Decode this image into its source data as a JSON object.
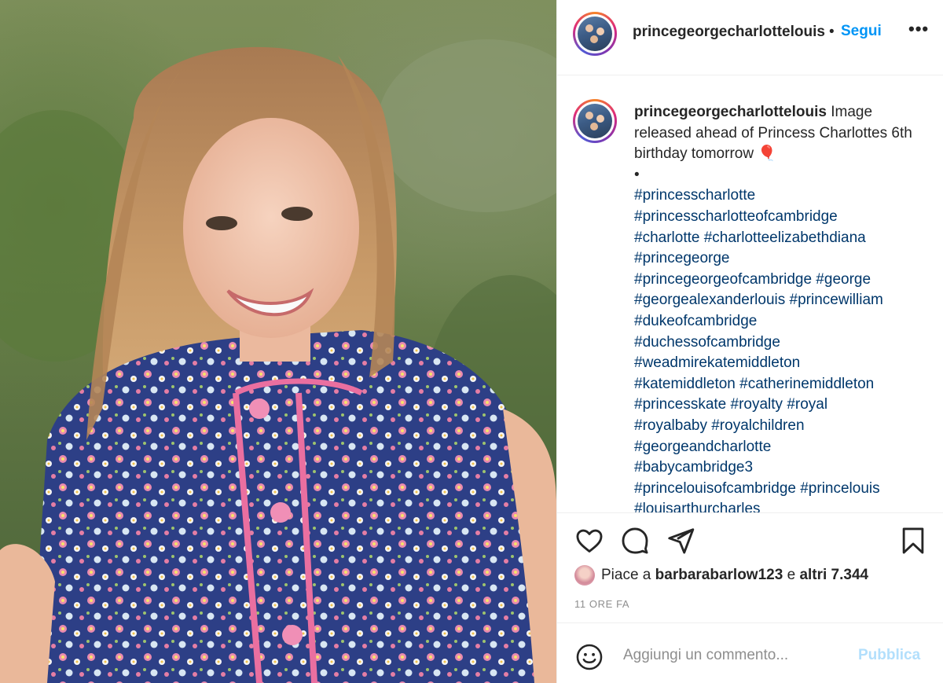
{
  "post": {
    "image_alt": "Princess Charlotte smiling in a floral dress"
  },
  "header": {
    "username": "princegeorgecharlottelouis",
    "separator": "•",
    "follow_label": "Segui",
    "more_label": "•••"
  },
  "caption": {
    "username": "princegeorgecharlottelouis",
    "text": "Image released ahead of Princess Charlottes 6th birthday tomorrow 🎈",
    "bullet": "•",
    "hashtags": [
      "#princesscharlotte",
      "#princesscharlotteofcambridge",
      "#charlotte #charlotteelizabethdiana",
      "#princegeorge",
      "#princegeorgeofcambridge #george",
      "#georgealexanderlouis #princewilliam",
      "#dukeofcambridge",
      "#duchessofcambridge",
      "#weadmirekatemiddleton",
      "#katemiddleton #catherinemiddleton",
      "#princesskate #royalty #royal",
      "#royalbaby #royalchildren",
      "#georgeandcharlotte",
      "#babycambridge3",
      "#princelouisofcambridge #princelouis",
      "#louisarthurcharles"
    ]
  },
  "likes": {
    "prefix": "Piace a",
    "user": "barbarabarlow123",
    "conjunction": "e",
    "others": "altri 7.344"
  },
  "timestamp": "11 ORE FA",
  "comment": {
    "placeholder": "Aggiungi un commento...",
    "publish_label": "Pubblica"
  },
  "colors": {
    "link": "#00376b",
    "accent": "#0095f6",
    "publish_disabled": "#b2dffc",
    "muted": "#8e8e8e"
  },
  "icons": [
    "heart-icon",
    "comment-icon",
    "share-icon",
    "bookmark-icon",
    "emoji-icon"
  ]
}
